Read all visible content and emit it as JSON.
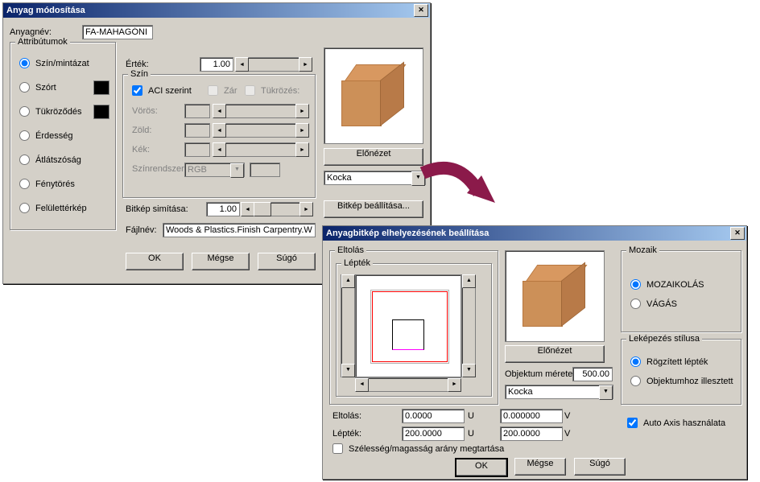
{
  "dialog1": {
    "title": "Anyag módosítása",
    "material_name_label": "Anyagnév:",
    "material_name_value": "FA-MAHAGÓNI",
    "attributes_group": "Attribútumok",
    "attr_radios": {
      "szin_mintazat": "Szín/mintázat",
      "szort": "Szórt",
      "tukrozodes": "Tükröződés",
      "erdesseg": "Érdesség",
      "atlatszosag": "Átlátszóság",
      "fenytores": "Fénytörés",
      "felulet": "Felülettérkép"
    },
    "ertek_label": "Érték:",
    "ertek_value": "1.00",
    "szin_group": "Szín",
    "aci_szerint": "ACI szerint",
    "zar": "Zár",
    "tukrozes": "Tükrözés:",
    "voros": "Vörös:",
    "zold": "Zöld:",
    "kek": "Kék:",
    "szinrendszer": "Színrendszer:",
    "rgb": "RGB",
    "elonezet": "Előnézet",
    "kocka": "Kocka",
    "bitkep_simitasa_label": "Bitkép simítása:",
    "bitkep_simitasa_value": "1.00",
    "bitkep_beallitasa": "Bitkép beállítása...",
    "fajlnev_label": "Fájlnév:",
    "fajlnev_value": "Woods & Plastics.Finish Carpentry.Woo",
    "ok": "OK",
    "megse": "Mégse",
    "sugo": "Súgó"
  },
  "dialog2": {
    "title": "Anyagbitkép elhelyezésének beállítása",
    "eltolas_group": "Eltolás",
    "leptek_group": "Lépték",
    "elonezet": "Előnézet",
    "objektum_merete_label": "Objektum mérete:",
    "objektum_merete_value": "500.00",
    "kocka": "Kocka",
    "eltolas_label": "Eltolás:",
    "eltolas_u": "0.0000",
    "eltolas_v": "0.000000",
    "leptek_label": "Lépték:",
    "leptek_u": "200.0000",
    "leptek_v": "200.0000",
    "u": "U",
    "v": "V",
    "szelesseg_arany": "Szélesség/magasság arány megtartása",
    "mozaik_group": "Mozaik",
    "mozaikolas": "MOZAIKOLÁS",
    "vagas": "VÁGÁS",
    "lekepzes_group": "Leképezés stílusa",
    "rogzitett_leptek": "Rögzített lépték",
    "objektumhoz": "Objektumhoz illesztett",
    "auto_axis": "Auto Axis használata",
    "ok": "OK",
    "megse": "Mégse",
    "sugo": "Súgó"
  }
}
